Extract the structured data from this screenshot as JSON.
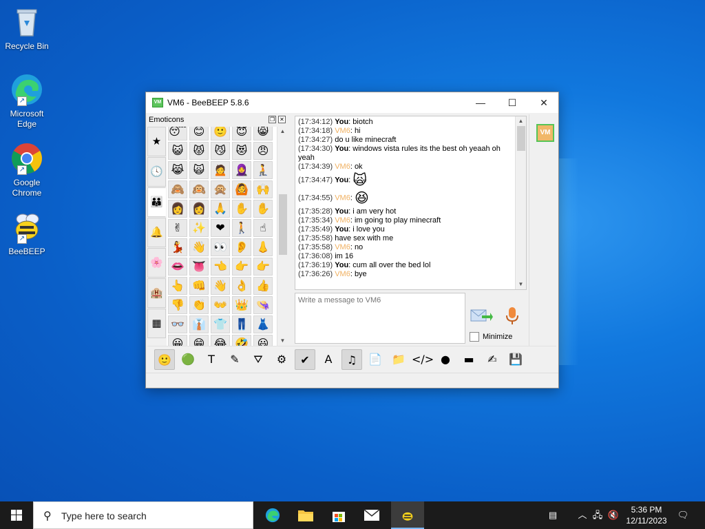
{
  "desktop": {
    "icons": [
      {
        "label": "Recycle Bin"
      },
      {
        "label": "Microsoft Edge"
      },
      {
        "label": "Google Chrome"
      },
      {
        "label": "BeeBEEP"
      }
    ]
  },
  "window": {
    "title": "VM6 - BeeBEEP 5.8.6",
    "logo_text": "VM",
    "controls": {
      "minimize": "—",
      "maximize": "☐",
      "close": "✕"
    }
  },
  "emoticons": {
    "title": "Emoticons",
    "tabs": [
      "★",
      "🕓",
      "👪",
      "🔔",
      "🌸",
      "🏨",
      "▦"
    ],
    "grid": [
      [
        "😴",
        "😊",
        "🙂",
        "😇",
        "😸"
      ],
      [
        "😺",
        "😾",
        "😼",
        "😻",
        "😠"
      ],
      [
        "😹",
        "🙀",
        "🙍",
        "🧕",
        "🧎"
      ],
      [
        "🙈",
        "🙉",
        "🙊",
        "🙆",
        "🙌"
      ],
      [
        "👩",
        "👩",
        "🙏",
        "✋",
        "✋"
      ],
      [
        "✌",
        "✨",
        "❤",
        "🚶",
        "☝"
      ],
      [
        "💃",
        "👋",
        "👀",
        "👂",
        "👃"
      ],
      [
        "👄",
        "👅",
        "👈",
        "👉",
        "👉"
      ],
      [
        "👆",
        "👊",
        "👋",
        "👌",
        "👍"
      ],
      [
        "👎",
        "👏",
        "👐",
        "👑",
        "👒"
      ],
      [
        "👓",
        "👔",
        "👕",
        "👖",
        "👗"
      ],
      [
        "😀",
        "😁",
        "😂",
        "🤣",
        "😃"
      ]
    ]
  },
  "chat": {
    "messages": [
      {
        "time": "(17:34:12)",
        "sender": "You",
        "text": ": biotch"
      },
      {
        "time": "(17:34:18)",
        "sender": "VM6",
        "text": ": hi"
      },
      {
        "time": "(17:34:27)",
        "sender": "",
        "text": "    do u like minecraft"
      },
      {
        "time": "(17:34:30)",
        "sender": "You",
        "text": ": windows vista rules its the best oh yeaah oh"
      },
      {
        "time": "",
        "sender": "",
        "text": "yeah"
      },
      {
        "time": "(17:34:39)",
        "sender": "VM6",
        "text": ": ok"
      },
      {
        "time": "(17:34:47)",
        "sender": "You",
        "text": ": ",
        "emoji": "🙀"
      },
      {
        "time": "(17:34:55)",
        "sender": "VM6",
        "text": ": ",
        "emoji": "😆"
      },
      {
        "time": "(17:35:28)",
        "sender": "You",
        "text": ": i am very hot"
      },
      {
        "time": "(17:35:34)",
        "sender": "VM6",
        "text": ": im going to play minecraft"
      },
      {
        "time": "(17:35:49)",
        "sender": "You",
        "text": ": i love you"
      },
      {
        "time": "(17:35:58)",
        "sender": "",
        "text": "    have sex with me"
      },
      {
        "time": "(17:35:58)",
        "sender": "VM6",
        "text": ": no"
      },
      {
        "time": "(17:36:08)",
        "sender": "",
        "text": "    im 16"
      },
      {
        "time": "(17:36:19)",
        "sender": "You",
        "text": ": cum all over the bed lol"
      },
      {
        "time": "(17:36:26)",
        "sender": "VM6",
        "text": ": bye"
      }
    ],
    "input_placeholder": "Write a message to VM6",
    "minimize_label": "Minimize"
  },
  "user_badge": "VM",
  "toolbar": [
    "🙂",
    "🟢",
    "T",
    "✎",
    "⛛",
    "⚙",
    "✔",
    "A",
    "♫",
    "📄",
    "📁",
    "</>",
    "●",
    "▬",
    "✍",
    "💾"
  ],
  "taskbar": {
    "search_placeholder": "Type here to search",
    "time": "5:36 PM",
    "date": "12/11/2023"
  },
  "colors": {
    "vm6_name": "#f0b060",
    "desktop_bg": "#0a5fc8",
    "taskbar": "#1b1b1b"
  }
}
